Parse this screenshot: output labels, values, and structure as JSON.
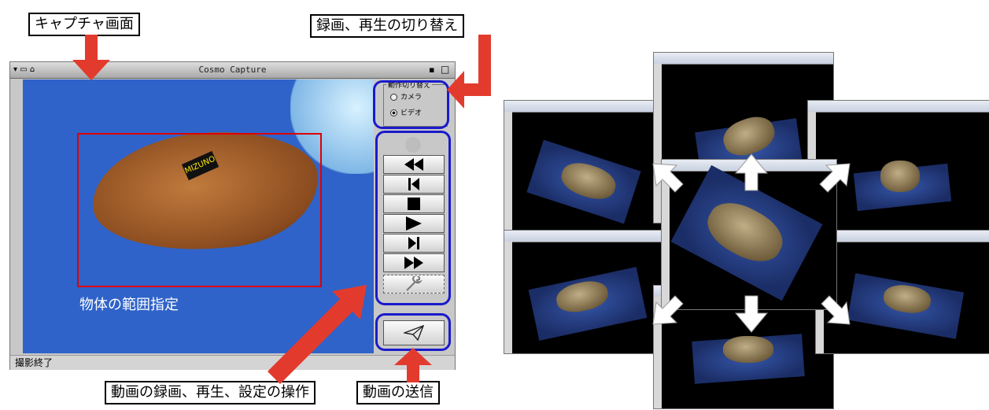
{
  "callouts": {
    "capture_screen": "キャプチャ画面",
    "mode_switch": "録画、再生の切り替え",
    "controls": "動画の録画、再生、設定の操作",
    "send": "動画の送信"
  },
  "window": {
    "title": "Cosmo Capture",
    "status": "撮影終了"
  },
  "mode_panel": {
    "legend": "動作切り替え",
    "options": [
      "カメラ",
      "ビデオ"
    ],
    "selected": "ビデオ"
  },
  "video": {
    "range_label": "物体の範囲指定",
    "glove_logo": "MIZUNO"
  },
  "buttons": [
    "record",
    "rewind",
    "step-back",
    "stop",
    "play",
    "step-forward",
    "fast-forward",
    "settings",
    "send"
  ],
  "colors": {
    "callout_arrow": "#e23b2e",
    "highlight": "#1a1acc",
    "selection": "#e00000",
    "video_bg": "#2f63c9"
  }
}
